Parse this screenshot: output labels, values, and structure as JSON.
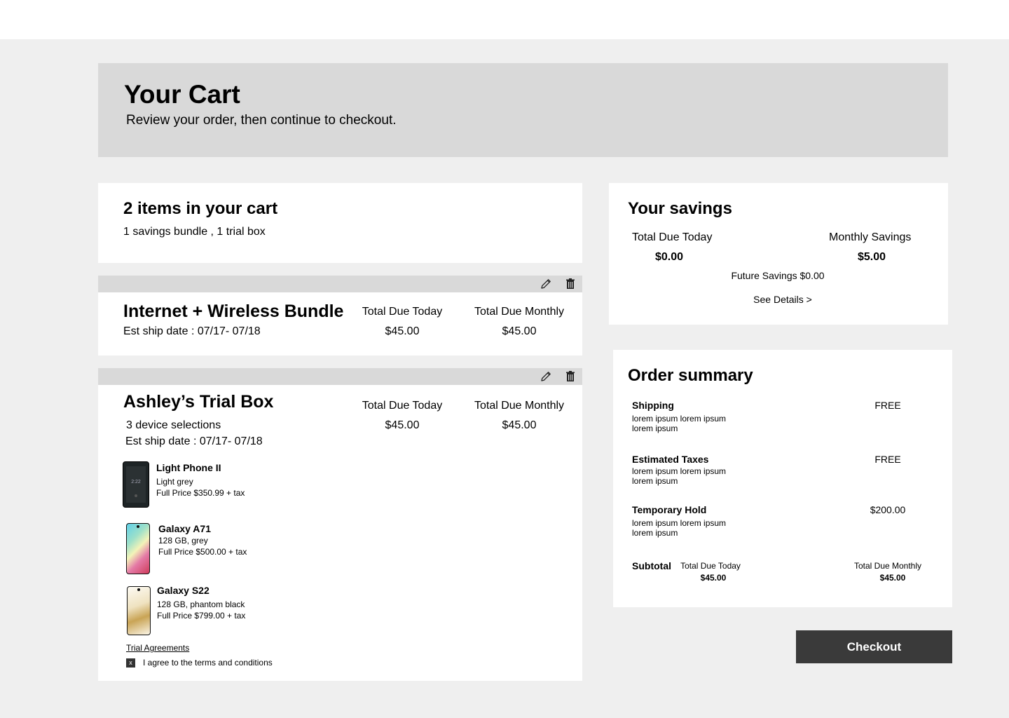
{
  "header": {
    "title": "Your Cart",
    "subtitle": "Review your order, then continue to checkout."
  },
  "cart_count": {
    "title": "2 items in your cart",
    "subtitle": "1 savings bundle , 1 trial box"
  },
  "icons": {
    "edit": "pencil-icon",
    "delete": "trash-icon"
  },
  "bundle": {
    "title": "Internet + Wireless Bundle",
    "ship_date": "Est ship date : 07/17- 07/18",
    "due_today_label": "Total Due Today",
    "due_today_value": "$45.00",
    "due_monthly_label": "Total Due Monthly",
    "due_monthly_value": "$45.00"
  },
  "trial_box": {
    "title": "Ashley’s Trial Box",
    "selections": "3 device selections",
    "ship_date": "Est ship date : 07/17- 07/18",
    "due_today_label": "Total Due Today",
    "due_today_value": "$45.00",
    "due_monthly_label": "Total Due Monthly",
    "due_monthly_value": "$45.00",
    "devices": [
      {
        "name": "Light Phone II",
        "detail": "Light grey",
        "price": "Full Price $350.99 + tax",
        "screen_time": "2:22"
      },
      {
        "name": "Galaxy A71",
        "detail": "128 GB, grey",
        "price": "Full Price $500.00 + tax"
      },
      {
        "name": "Galaxy S22",
        "detail": "128 GB, phantom black",
        "price": "Full Price $799.00 + tax"
      }
    ],
    "agreements_link": "Trial Agreements",
    "agree_mark": "x",
    "agree_label": "I agree to the terms and conditions"
  },
  "savings": {
    "title": "Your savings",
    "due_today_label": "Total Due Today",
    "due_today_value": "$0.00",
    "monthly_label": "Monthly Savings",
    "monthly_value": "$5.00",
    "future": "Future Savings $0.00",
    "details_link": "See Details >"
  },
  "summary": {
    "title": "Order summary",
    "rows": [
      {
        "label": "Shipping",
        "desc1": "lorem ipsum lorem ipsum",
        "desc2": "lorem ipsum",
        "value": "FREE"
      },
      {
        "label": "Estimated Taxes",
        "desc1": "lorem ipsum lorem ipsum",
        "desc2": "lorem ipsum",
        "value": "FREE"
      },
      {
        "label": "Temporary Hold",
        "desc1": "lorem ipsum lorem ipsum",
        "desc2": "lorem ipsum",
        "value": "$200.00"
      }
    ],
    "subtotal_label": "Subtotal",
    "subtotal_today_label": "Total Due Today",
    "subtotal_today_value": "$45.00",
    "subtotal_monthly_label": "Total Due Monthly",
    "subtotal_monthly_value": "$45.00"
  },
  "checkout_label": "Checkout"
}
